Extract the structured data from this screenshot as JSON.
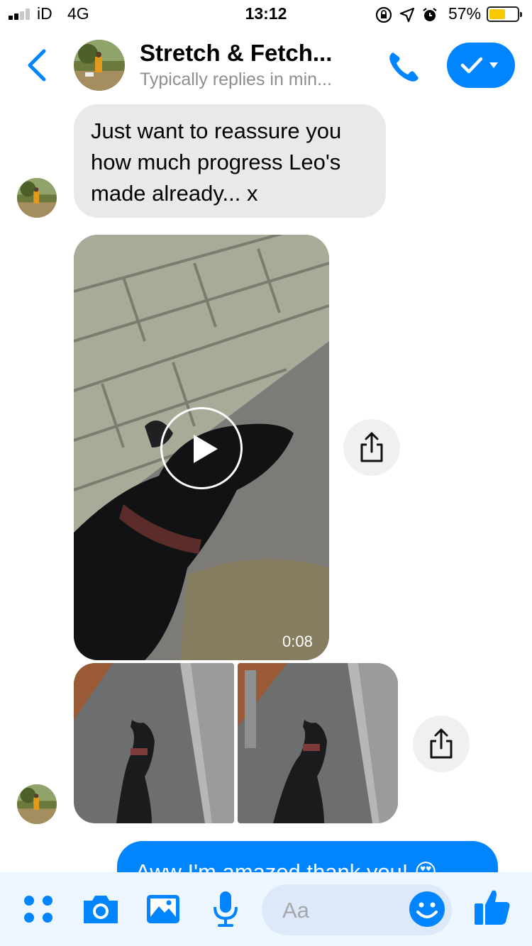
{
  "status_bar": {
    "carrier": "iD",
    "network": "4G",
    "time": "13:12",
    "battery_percent": "57%",
    "battery_level": 0.57,
    "icons": [
      "orientation-lock-icon",
      "location-arrow-icon",
      "alarm-clock-icon"
    ]
  },
  "header": {
    "contact_name": "Stretch & Fetch...",
    "contact_status": "Typically replies in min...",
    "icons": [
      "back-chevron-icon",
      "phone-icon",
      "checkmark-dropdown-icon"
    ]
  },
  "messages": {
    "incoming_text": "Just want to reassure you how much progress Leo's made already... x",
    "video_duration": "0:08",
    "outgoing_text": "Aww I'm amazed thank you! 😍"
  },
  "composer": {
    "placeholder": "Aa",
    "icons": [
      "apps-grid-icon",
      "camera-icon",
      "photo-gallery-icon",
      "microphone-icon",
      "emoji-icon",
      "thumbs-up-icon"
    ]
  },
  "colors": {
    "accent": "#0084ff",
    "incoming_bubble": "#e9e9eb",
    "composer_bg": "#eef6ff",
    "battery_fill": "#f8c900"
  }
}
